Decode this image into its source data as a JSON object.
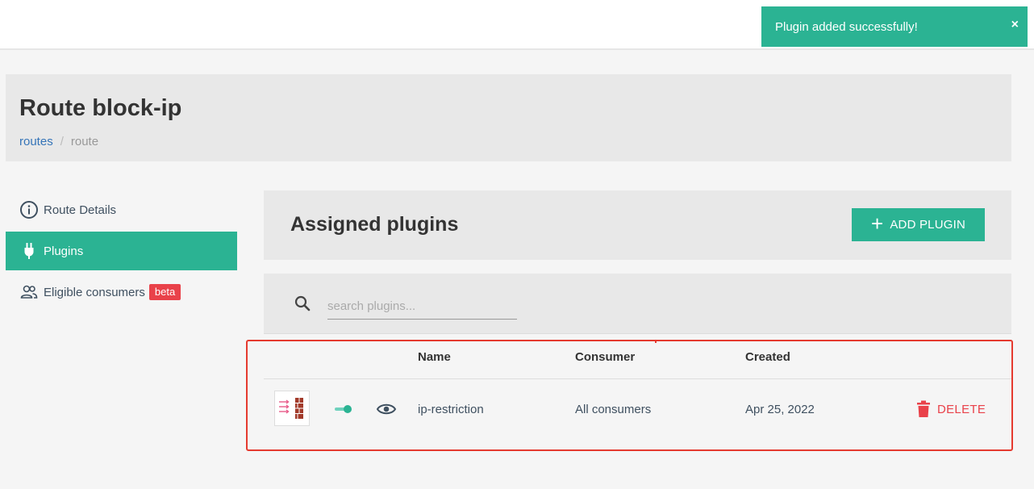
{
  "toast": {
    "message": "Plugin added successfully!",
    "close": "×"
  },
  "page": {
    "title": "Route block-ip"
  },
  "breadcrumb": {
    "link": "routes",
    "separator": "/",
    "current": "route"
  },
  "sidebar": {
    "items": [
      {
        "label": "Route Details",
        "icon": "info-icon",
        "active": false
      },
      {
        "label": "Plugins",
        "icon": "plug-icon",
        "active": true
      },
      {
        "label": "Eligible consumers",
        "icon": "users-icon",
        "active": false,
        "badge": "beta"
      }
    ]
  },
  "plugins": {
    "title": "Assigned plugins",
    "add_button": "ADD PLUGIN",
    "search_placeholder": "search plugins...",
    "columns": {
      "name": "Name",
      "consumer": "Consumer",
      "created": "Created"
    },
    "rows": [
      {
        "name": "ip-restriction",
        "consumer": "All consumers",
        "created": "Apr 25, 2022",
        "enabled": true,
        "delete_label": "DELETE"
      }
    ]
  },
  "colors": {
    "accent": "#2bb393",
    "danger": "#e9424a",
    "link": "#3574b8",
    "highlight": "#e53a2f"
  }
}
